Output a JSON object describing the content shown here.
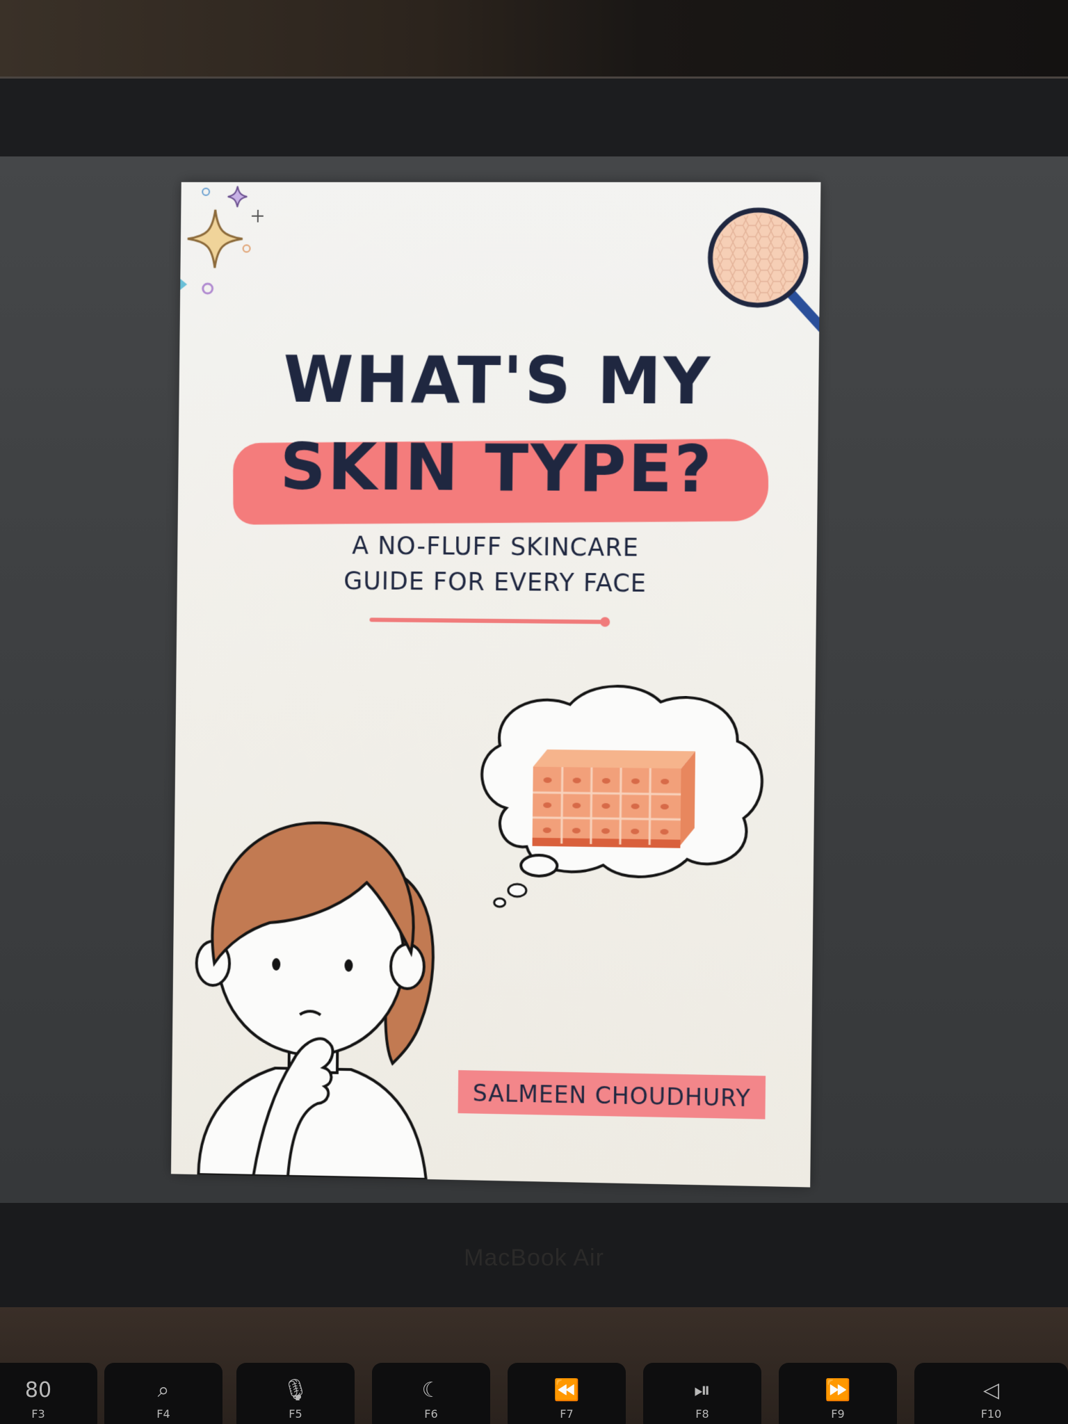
{
  "device": {
    "bezel_label": "MacBook Air"
  },
  "book": {
    "title_line_1": "WHAT'S MY",
    "title_line_2": "SKIN TYPE?",
    "subtitle_line_1": "A NO-FLUFF SKINCARE",
    "subtitle_line_2": "GUIDE FOR EVERY FACE",
    "author": "SALMEEN CHOUDHURY",
    "colors": {
      "navy": "#1f2740",
      "coral": "#f47c7c",
      "hair": "#c27a52",
      "skin_cells": "#f0a070",
      "cover_bg": "#f2f0ea"
    }
  },
  "keyboard": {
    "keys": [
      {
        "glyph": "80",
        "fn": "F3",
        "icon": "mission-control-icon"
      },
      {
        "glyph": "⌕",
        "fn": "F4",
        "icon": "search-icon"
      },
      {
        "glyph": "🎙",
        "fn": "F5",
        "icon": "microphone-icon"
      },
      {
        "glyph": "☾",
        "fn": "F6",
        "icon": "moon-icon"
      },
      {
        "glyph": "⏪",
        "fn": "F7",
        "icon": "rewind-icon"
      },
      {
        "glyph": "⏯",
        "fn": "F8",
        "icon": "play-pause-icon"
      },
      {
        "glyph": "⏩",
        "fn": "F9",
        "icon": "fast-forward-icon"
      },
      {
        "glyph": "◁",
        "fn": "F10",
        "icon": "mute-icon"
      }
    ]
  }
}
